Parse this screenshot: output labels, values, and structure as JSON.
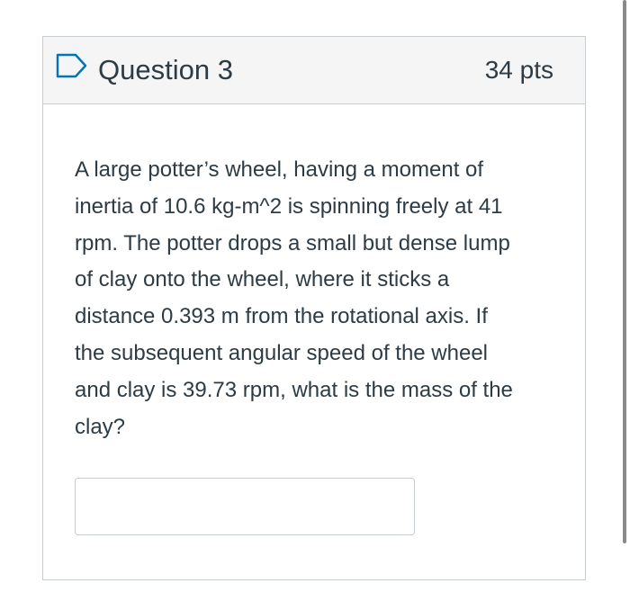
{
  "question": {
    "title": "Question 3",
    "points": "34 pts",
    "flag_icon": "flag-outline-icon",
    "text_lines": [
      "A large potter’s wheel, having a moment of",
      "inertia of 10.6 kg-m^2 is spinning freely at 41",
      "rpm. The potter drops a small but dense lump",
      "of clay onto the wheel, where it sticks a",
      "distance 0.393 m from the rotational axis. If",
      "the subsequent angular speed of the wheel",
      "and clay is 39.73 rpm, what is the mass of the",
      "clay?"
    ],
    "answer": {
      "value": "",
      "placeholder": ""
    }
  },
  "colors": {
    "header_bg": "#f5f5f5",
    "border": "#c7cdd1",
    "text": "#2d3b45",
    "flag_accent": "#0374b5"
  }
}
